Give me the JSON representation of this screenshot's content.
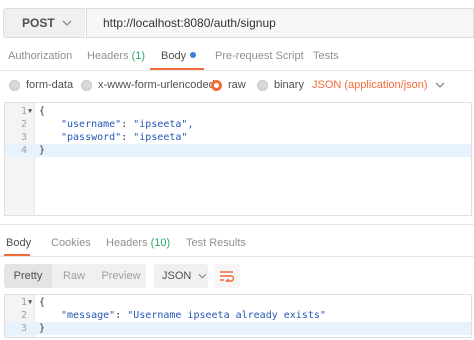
{
  "request": {
    "method": "POST",
    "url": "http://localhost:8080/auth/signup"
  },
  "request_tabs": [
    {
      "label": "Authorization"
    },
    {
      "label": "Headers",
      "count": "(1)"
    },
    {
      "label": "Body",
      "active": true
    },
    {
      "label": "Pre-request Script"
    },
    {
      "label": "Tests"
    }
  ],
  "body_types": [
    {
      "label": "form-data",
      "selected": false
    },
    {
      "label": "x-www-form-urlencoded",
      "selected": false
    },
    {
      "label": "raw",
      "selected": true
    },
    {
      "label": "binary",
      "selected": false
    }
  ],
  "content_type": "JSON (application/json)",
  "request_body": {
    "lines": [
      {
        "num": "1",
        "text": "{"
      },
      {
        "num": "2",
        "key": "\"username\"",
        "value": "\"ipseeta\","
      },
      {
        "num": "3",
        "key": "\"password\"",
        "value": "\"ipseeta\""
      },
      {
        "num": "4",
        "text": "}"
      }
    ]
  },
  "response_tabs": [
    {
      "label": "Body",
      "active": true
    },
    {
      "label": "Cookies"
    },
    {
      "label": "Headers",
      "count": "(10)"
    },
    {
      "label": "Test Results"
    }
  ],
  "response_view": {
    "modes": [
      "Pretty",
      "Raw",
      "Preview"
    ],
    "active_mode": "Pretty",
    "format": "JSON"
  },
  "response_body": {
    "lines": [
      {
        "num": "1",
        "text": "{"
      },
      {
        "num": "2",
        "key": "\"message\"",
        "value": "\"Username ipseeta already exists\""
      },
      {
        "num": "3",
        "text": "}"
      }
    ]
  },
  "colors": {
    "accent": "#f26b3a",
    "count": "#27a86a",
    "json_string": "#2357b5",
    "active_line": "#e8f2fc"
  },
  "icons": {
    "method_dropdown": "chevron-down-icon",
    "content_type_dropdown": "chevron-down-icon",
    "format_dropdown": "chevron-down-icon",
    "wrap": "wrap-lines-icon",
    "fold": "fold-arrow-icon",
    "body_tab_dot": "dot-icon"
  }
}
